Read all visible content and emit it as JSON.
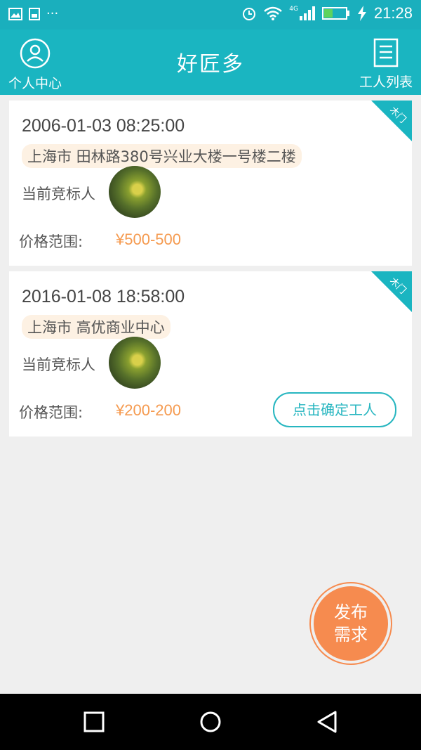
{
  "status_bar": {
    "time": "21:28",
    "network": "4G",
    "left_icons": [
      "image-icon",
      "sync-icon",
      "more-icon"
    ],
    "right_icons": [
      "alarm-icon",
      "wifi-icon",
      "signal-icon",
      "battery-icon",
      "charging-icon"
    ],
    "battery_fraction": 0.4
  },
  "header": {
    "title": "好匠多",
    "left_label": "个人中心",
    "right_label": "工人列表"
  },
  "colors": {
    "accent": "#1ab5c1",
    "price": "#f59a4f",
    "fab": "#f68b4f",
    "address_bg": "#fdf1e3"
  },
  "orders": [
    {
      "datetime": "2006-01-03 08:25:00",
      "address": "上海市 田林路380号兴业大楼一号楼二楼",
      "bidder_label": "当前竞标人",
      "price_label": "价格范围:",
      "price": "¥500-500",
      "tag": "木门"
    },
    {
      "datetime": "2016-01-08 18:58:00",
      "address": "上海市 高优商业中心",
      "bidder_label": "当前竞标人",
      "price_label": "价格范围:",
      "price": "¥200-200",
      "tag": "木门",
      "confirm_label": "点击确定工人"
    }
  ],
  "fab": {
    "line1": "发布",
    "line2": "需求"
  }
}
